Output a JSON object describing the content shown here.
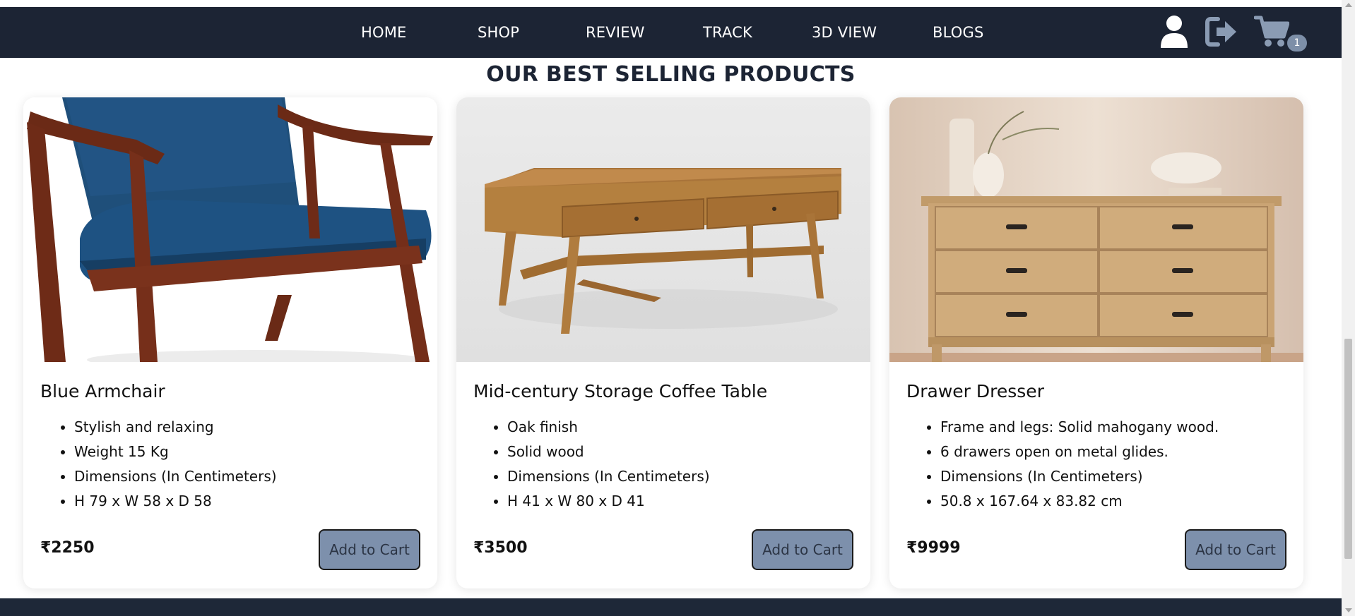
{
  "nav": {
    "links": [
      "HOME",
      "SHOP",
      "REVIEW",
      "TRACK",
      "3D VIEW",
      "BLOGS"
    ],
    "icons": [
      "user-icon",
      "logout-icon",
      "cart-icon"
    ],
    "cart_count": "1",
    "colors": {
      "background": "#1c2434",
      "icon": "#ffffff",
      "icon_muted": "#8a9bb3",
      "badge": "#7d8fa8"
    }
  },
  "section": {
    "title": "OUR BEST SELLING PRODUCTS"
  },
  "products": [
    {
      "name": "Blue Armchair",
      "features": [
        "Stylish and relaxing",
        "Weight 15 Kg",
        "Dimensions (In Centimeters)",
        "H 79 x W 58 x D 58"
      ],
      "price": "₹2250",
      "button": "Add to Cart",
      "image": "blue-armchair-image"
    },
    {
      "name": "Mid-century Storage Coffee Table",
      "features": [
        "Oak finish",
        "Solid wood",
        "Dimensions (In Centimeters)",
        "H 41 x W 80 x D 41"
      ],
      "price": "₹3500",
      "button": "Add to Cart",
      "image": "coffee-table-image"
    },
    {
      "name": "Drawer Dresser",
      "features": [
        "Frame and legs: Solid mahogany wood.",
        "6 drawers open on metal glides.",
        "Dimensions (In Centimeters)",
        "50.8 x 167.64 x 83.82 cm"
      ],
      "price": "₹9999",
      "button": "Add to Cart",
      "image": "drawer-dresser-image"
    }
  ],
  "colors": {
    "button": "#7d90ac",
    "title": "#1c2434",
    "footer": "#1e2838"
  }
}
